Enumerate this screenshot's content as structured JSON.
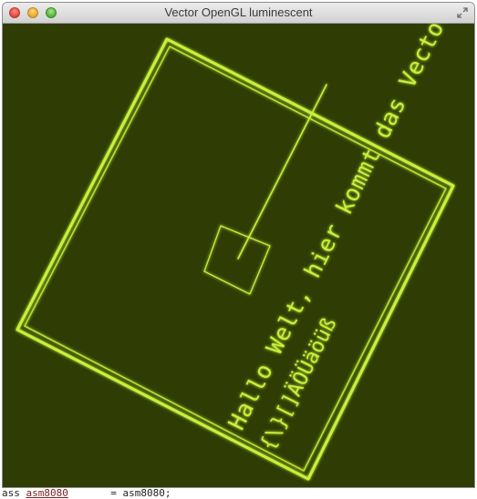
{
  "window": {
    "title": "Vector OpenGL luminescent",
    "controls": {
      "close_icon": "close-icon",
      "minimize_icon": "minimize-icon",
      "zoom_icon": "zoom-icon",
      "fullscreen_icon": "fullscreen-icon"
    }
  },
  "canvas": {
    "background": "#2f3d05",
    "line_color": "#c7f03a",
    "glow_color": "#9dd21a",
    "text_line1": "Hallo Welt, hier kommt das Vector-Display!",
    "text_line2": "{\\}[]ÄÖÜäöüß"
  },
  "background_editor": {
    "fragment_left": "ass ",
    "fragment_kw": "asm8080",
    "fragment_right": "       = asm8080;"
  }
}
